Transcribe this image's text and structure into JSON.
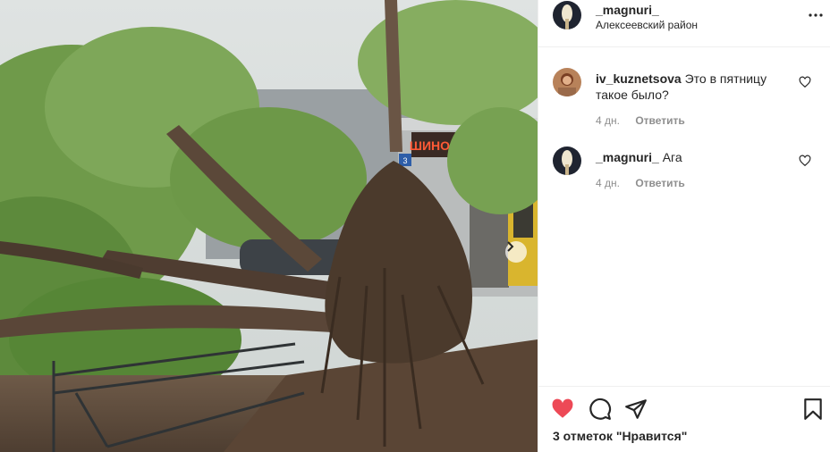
{
  "post": {
    "author": "_magnuri_",
    "location": "Алексеевский район",
    "photo_alt": "Поваленное дерево у шиномонтажа",
    "sign_text": "ШИНОМОНТАЖ",
    "building_number": "3"
  },
  "comments": [
    {
      "username": "iv_kuznetsova",
      "text": "Это в пятницу такое было?",
      "time": "4 дн.",
      "reply_label": "Ответить",
      "avatar_icon": "user-avatar-photo"
    },
    {
      "username": "_magnuri_",
      "text": "Ага",
      "time": "4 дн.",
      "reply_label": "Ответить",
      "avatar_icon": "user-avatar-photo"
    }
  ],
  "actions": {
    "like_icon": "heart-filled-icon",
    "comment_icon": "comment-icon",
    "share_icon": "paper-plane-icon",
    "save_icon": "bookmark-icon",
    "like_state": "liked"
  },
  "likes_text": "3 отметок \"Нравится\"",
  "colors": {
    "like_red": "#ed4956",
    "text": "#262626",
    "secondary": "#8e8e8e",
    "sign_red": "#d83a1e",
    "divider": "#efefef"
  }
}
